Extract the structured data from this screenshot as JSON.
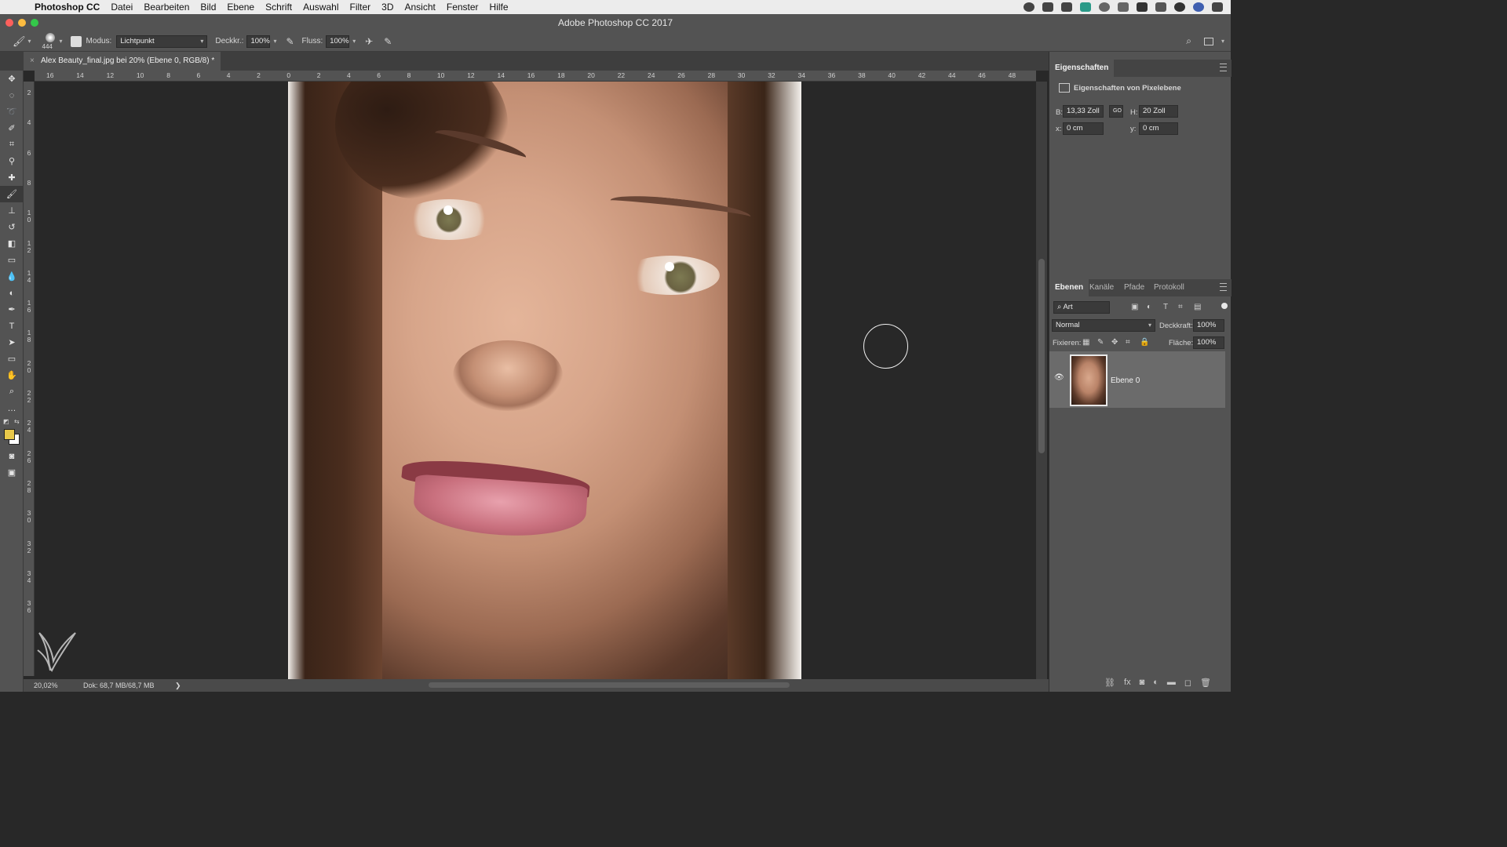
{
  "menubar": {
    "app": "Photoshop CC",
    "items": [
      "Datei",
      "Bearbeiten",
      "Bild",
      "Ebene",
      "Schrift",
      "Auswahl",
      "Filter",
      "3D",
      "Ansicht",
      "Fenster",
      "Hilfe"
    ]
  },
  "window": {
    "title": "Adobe Photoshop CC 2017"
  },
  "options": {
    "brush_size": "444",
    "mode_label": "Modus:",
    "mode_value": "Lichtpunkt",
    "opacity_label": "Deckkr.:",
    "opacity_value": "100%",
    "flow_label": "Fluss:",
    "flow_value": "100%"
  },
  "document": {
    "tab_title": "Alex Beauty_final.jpg bei 20% (Ebene 0, RGB/8) *"
  },
  "ruler_top": [
    "16",
    "14",
    "12",
    "10",
    "8",
    "6",
    "4",
    "2",
    "0",
    "2",
    "4",
    "6",
    "8",
    "10",
    "12",
    "14",
    "16",
    "18",
    "20",
    "22",
    "24",
    "26",
    "28",
    "30",
    "32",
    "34",
    "36",
    "38",
    "40",
    "42",
    "44",
    "46",
    "48"
  ],
  "ruler_left": [
    "2",
    "4",
    "6",
    "8",
    "10",
    "12",
    "14",
    "16",
    "18",
    "20",
    "22",
    "24",
    "26",
    "28",
    "30",
    "32",
    "34",
    "36"
  ],
  "status": {
    "zoom": "20,02%",
    "doc": "Dok: 68,7 MB/68,7 MB",
    "arrow": "❯"
  },
  "properties": {
    "tab": "Eigenschaften",
    "subtitle": "Eigenschaften von Pixelebene",
    "w_label": "B:",
    "w_value": "13,33 Zoll",
    "h_label": "H:",
    "h_value": "20 Zoll",
    "x_label": "x:",
    "x_value": "0 cm",
    "y_label": "y:",
    "y_value": "0 cm",
    "link_label": "GO"
  },
  "layers_panel": {
    "tabs": [
      "Ebenen",
      "Kanäle",
      "Pfade",
      "Protokoll"
    ],
    "filter_value": "Art",
    "blend_mode": "Normal",
    "opacity_label": "Deckkraft:",
    "opacity_value": "100%",
    "lock_label": "Fixieren:",
    "fill_label": "Fläche:",
    "fill_value": "100%",
    "layers": [
      {
        "name": "Ebene 0",
        "visible": true
      }
    ]
  },
  "colors": {
    "foreground": "#e8c84a",
    "background": "#ffffff",
    "ui_dark": "#282828",
    "ui_panel": "#535353"
  }
}
